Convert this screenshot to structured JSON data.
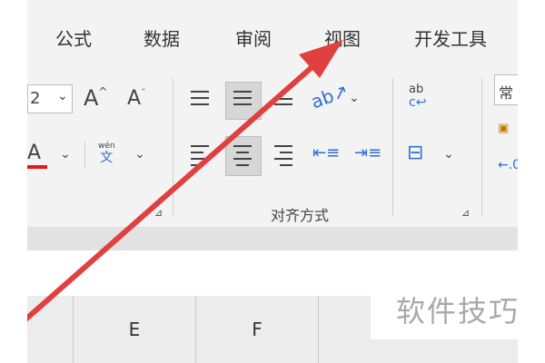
{
  "tabs": {
    "formulas": "公式",
    "data": "数据",
    "review": "审阅",
    "view": "视图",
    "developer": "开发工具"
  },
  "font": {
    "size_fragment": "2",
    "grow_label": "A",
    "shrink_label": "A",
    "color_label": "A",
    "pinyin_top": "wén",
    "pinyin_bottom": "文"
  },
  "alignment": {
    "group_label": "对齐方式",
    "wrap_text_label": "ab"
  },
  "number": {
    "format_fragment": "常"
  },
  "columns": [
    "E",
    "F"
  ],
  "watermark": "软件技巧",
  "colors": {
    "ribbon_bg": "#f3f3f3",
    "selected_bg": "#d7d7d7",
    "arrow": "#e0403f",
    "font_color_bar": "#e8151b",
    "wrap_icon_blue": "#2f6fcf"
  }
}
